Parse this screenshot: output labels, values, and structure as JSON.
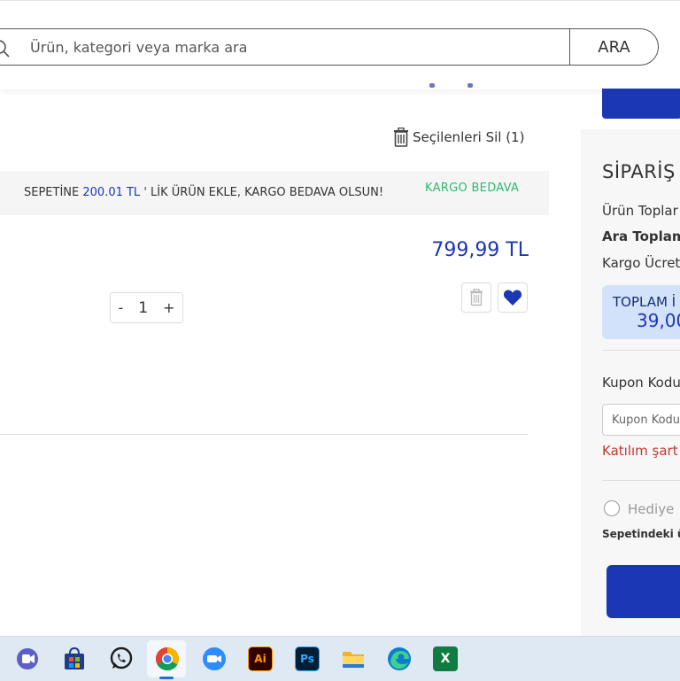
{
  "search": {
    "placeholder": "Ürün, kategori veya marka ara",
    "button_label": "ARA"
  },
  "cart": {
    "delete_selected_label": "Seçilenleri Sil (1)",
    "banner": {
      "text_before": "SEPETİNE ",
      "amount": "200.01 TL",
      "text_after": " ' LİK ÜRÜN EKLE, KARGO BEDAVA OLSUN!",
      "badge": "KARGO BEDAVA"
    },
    "item": {
      "price": "799,99 TL",
      "quantity": "1",
      "decrement_label": "-",
      "increment_label": "+"
    }
  },
  "summary": {
    "title": "SİPARİŞ",
    "product_total_label": "Ürün Toplar",
    "subtotal_label": "Ara Toplam",
    "shipping_label": "Kargo Ücret",
    "total_label": "TOPLAM İ",
    "total_value": "39,00",
    "coupon_label": "Kupon Kodu",
    "coupon_placeholder": "Kupon Kodu",
    "terms_link": "Katılım şart",
    "gift_label": "Hediye",
    "gift_note": "Sepetindeki ü"
  },
  "taskbar": {
    "apps": [
      "teams-icon",
      "store-icon",
      "whatsapp-icon",
      "chrome-icon",
      "zoom-icon",
      "illustrator-icon",
      "photoshop-icon",
      "file-explorer-icon",
      "edge-icon",
      "excel-icon"
    ],
    "illustrator_text": "Ai",
    "photoshop_text": "Ps",
    "excel_text": "X"
  },
  "colors": {
    "brand_blue": "#1c37b5",
    "free_shipping_green": "#2eb872",
    "terms_red": "#c0392b",
    "total_box_bg": "#d2e2fa"
  }
}
